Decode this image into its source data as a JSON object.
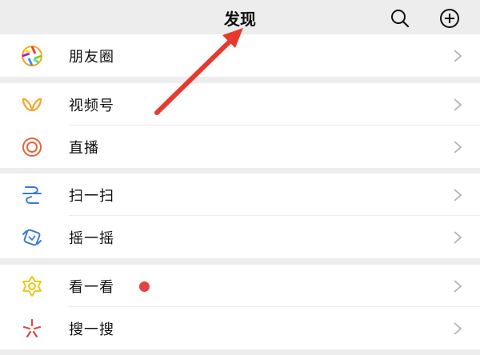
{
  "header": {
    "title": "发现",
    "search_icon": "search-icon",
    "add_icon": "plus-circle-icon"
  },
  "items": [
    {
      "label": "朋友圈",
      "icon": "moments-aperture-icon"
    },
    {
      "label": "视频号",
      "icon": "channels-butterfly-icon"
    },
    {
      "label": "直播",
      "icon": "live-ring-icon"
    },
    {
      "label": "扫一扫",
      "icon": "scan-icon"
    },
    {
      "label": "摇一摇",
      "icon": "shake-icon"
    },
    {
      "label": "看一看",
      "icon": "top-stories-icon",
      "badge": "red-dot"
    },
    {
      "label": "搜一搜",
      "icon": "search-sparkle-icon"
    }
  ],
  "colors": {
    "background": "#ededed",
    "badge": "#e64340",
    "chevron": "#b2b2b2",
    "annotation_arrow": "#e8392f"
  }
}
